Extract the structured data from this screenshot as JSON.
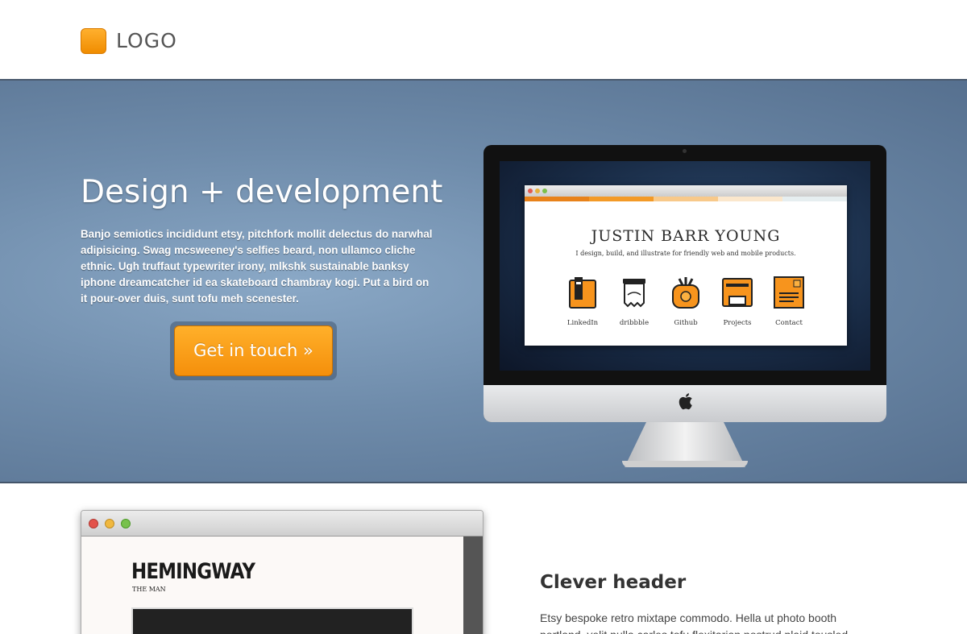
{
  "header": {
    "logo_text": "LOGO",
    "logo_color": "#f7941d"
  },
  "hero": {
    "title": "Design + development",
    "text": "Banjo semiotics incididunt etsy, pitchfork mollit delectus do narwhal adipisicing. Swag mcsweeney's selfies beard, non ullamco cliche ethnic. Ugh truffaut typewriter irony, mlkshk sustainable banksy iphone dreamcatcher id ea skateboard chambray kogi. Put a bird on it pour-over duis, sunt tofu meh scenester.",
    "cta_label": "Get in touch »",
    "accent": "#f7941d"
  },
  "imac_screen": {
    "name": "JUSTIN BARR YOUNG",
    "tagline": "I design, build, and illustrate for friendly web and mobile products.",
    "icons": [
      {
        "label": "LinkedIn",
        "icon": "linkedin-book-icon"
      },
      {
        "label": "dribbble",
        "icon": "dribbble-paper-icon"
      },
      {
        "label": "Github",
        "icon": "github-jar-icon"
      },
      {
        "label": "Projects",
        "icon": "projects-briefcase-icon"
      },
      {
        "label": "Contact",
        "icon": "contact-letter-icon"
      }
    ]
  },
  "content": {
    "browser": {
      "title": "HEMINGWAY",
      "subtitle": "THE MAN"
    },
    "header": "Clever header",
    "text": "Etsy bespoke retro mixtape commodo. Hella ut photo booth portland, velit nulla carles tofu flexitarian nostrud plaid tousled"
  }
}
